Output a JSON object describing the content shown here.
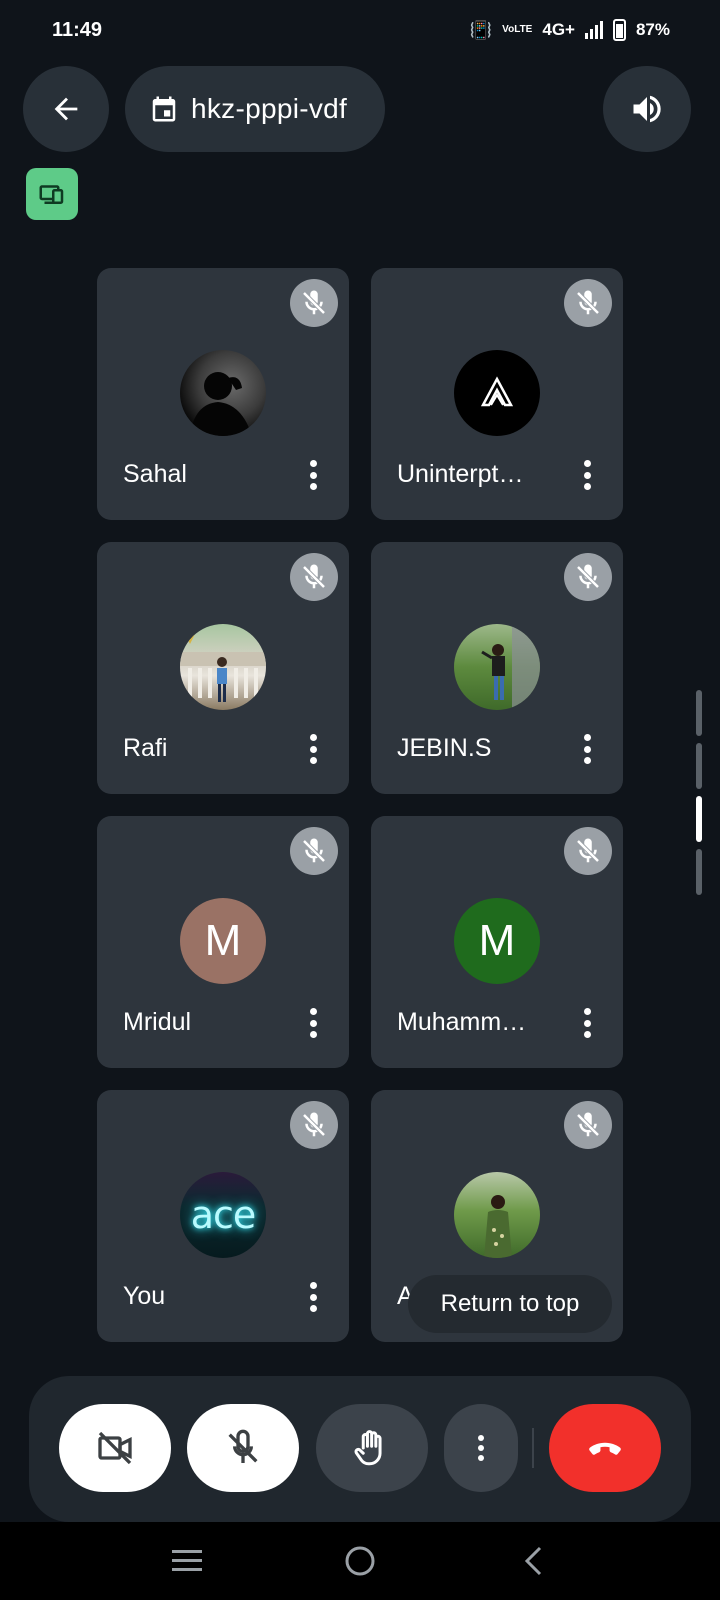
{
  "status_bar": {
    "time": "11:49",
    "network": "4G+",
    "volte": "VoLTE",
    "battery": "87%"
  },
  "header": {
    "meeting_code": "hkz-pppi-vdf",
    "back_icon": "arrow-left-icon",
    "calendar_icon": "calendar-icon",
    "speaker_icon": "speaker-icon"
  },
  "present_badge_icon": "devices-icon",
  "participants": [
    {
      "name": "Sahal",
      "avatar_type": "photo",
      "avatar_color": "#6b6b6b",
      "mic_muted": true
    },
    {
      "name": "Uninterpt…",
      "avatar_type": "logo",
      "avatar_color": "#000000",
      "mic_muted": true
    },
    {
      "name": "Rafi",
      "avatar_type": "photo",
      "avatar_color": "#8fa8a0",
      "mic_muted": true
    },
    {
      "name": "JEBIN.S",
      "avatar_type": "photo",
      "avatar_color": "#4f7a3e",
      "mic_muted": true
    },
    {
      "name": "Mridul",
      "avatar_type": "letter",
      "letter": "M",
      "avatar_color": "#9a7265",
      "mic_muted": true
    },
    {
      "name": "Muhamm…",
      "avatar_type": "letter",
      "letter": "M",
      "avatar_color": "#1f6b1d",
      "mic_muted": true
    },
    {
      "name": "You",
      "avatar_type": "text-logo",
      "logo_text": "ace",
      "avatar_color": "#0c2a30",
      "mic_muted": true
    },
    {
      "name": "AR",
      "avatar_type": "photo",
      "avatar_color": "#5a7a3c",
      "mic_muted": true
    }
  ],
  "return_to_top_label": "Return to top",
  "controls": {
    "camera_icon": "camera-off-icon",
    "mic_icon": "mic-off-icon",
    "hand_icon": "raise-hand-icon",
    "more_icon": "more-vert-icon",
    "end_call_icon": "end-call-icon",
    "end_call_color": "#f2302b"
  },
  "nav": {
    "recents_icon": "recents-icon",
    "home_icon": "home-icon",
    "back_icon": "nav-back-icon"
  }
}
